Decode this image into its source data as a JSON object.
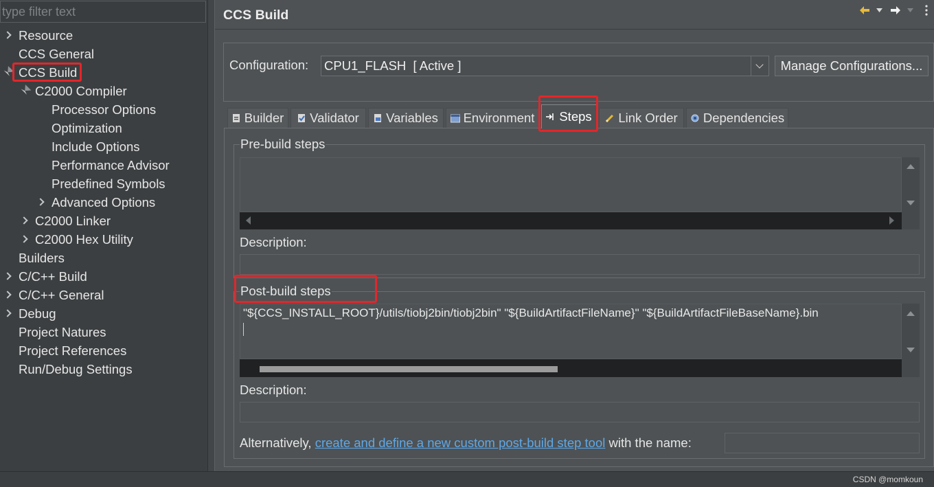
{
  "filter": {
    "placeholder": "type filter text"
  },
  "tree": [
    {
      "label": "Resource",
      "icon": "chevron-right-icon"
    },
    {
      "label": "CCS General"
    },
    {
      "label": "CCS Build",
      "icon": "chevron-down-icon"
    },
    {
      "label": "C2000 Compiler",
      "icon": "chevron-down-icon"
    },
    {
      "label": "Processor Options"
    },
    {
      "label": "Optimization"
    },
    {
      "label": "Include Options"
    },
    {
      "label": "Performance Advisor"
    },
    {
      "label": "Predefined Symbols"
    },
    {
      "label": "Advanced Options",
      "icon": "chevron-right-icon"
    },
    {
      "label": "C2000 Linker",
      "icon": "chevron-right-icon"
    },
    {
      "label": "C2000 Hex Utility",
      "icon": "chevron-right-icon"
    },
    {
      "label": "Builders"
    },
    {
      "label": "C/C++ Build",
      "icon": "chevron-right-icon"
    },
    {
      "label": "C/C++ General",
      "icon": "chevron-right-icon"
    },
    {
      "label": "Debug",
      "icon": "chevron-right-icon"
    },
    {
      "label": "Project Natures"
    },
    {
      "label": "Project References"
    },
    {
      "label": "Run/Debug Settings"
    }
  ],
  "header": {
    "title": "CCS Build",
    "toolbar_icons": [
      "back-arrow-icon",
      "back-history-menu-icon",
      "forward-arrow-icon",
      "forward-history-menu-icon",
      "more-options-icon"
    ]
  },
  "configuration": {
    "label": "Configuration:",
    "value": "CPU1_FLASH  [ Active ]",
    "manage_button": "Manage Configurations..."
  },
  "tabs": [
    {
      "label": "Builder",
      "icon": "builder-icon"
    },
    {
      "label": "Validator",
      "icon": "validator-icon"
    },
    {
      "label": "Variables",
      "icon": "variables-icon"
    },
    {
      "label": "Environment",
      "icon": "environment-icon"
    },
    {
      "label": "Steps",
      "icon": "steps-icon",
      "active": true
    },
    {
      "label": "Link Order",
      "icon": "link-order-icon"
    },
    {
      "label": "Dependencies",
      "icon": "dependencies-icon"
    }
  ],
  "pre_build": {
    "group_label": "Pre-build steps",
    "command": "",
    "description_label": "Description:",
    "description": ""
  },
  "post_build": {
    "group_label": "Post-build steps",
    "command": "\"${CCS_INSTALL_ROOT}/utils/tiobj2bin/tiobj2bin\" \"${BuildArtifactFileName}\" \"${BuildArtifactFileBaseName}.bin",
    "description_label": "Description:",
    "description": "",
    "horizontal_scroll": {
      "position_percent": 3,
      "visible_percent": 45
    }
  },
  "custom_tool": {
    "prefix": "Alternatively, ",
    "link": "create and define a new custom post-build step tool",
    "suffix": " with the name:",
    "name": ""
  },
  "watermark": "CSDN @momkoun",
  "colors": {
    "link": "#5ea8e8",
    "highlight": "#e3262b",
    "back_arrow": "#e7b93b"
  }
}
